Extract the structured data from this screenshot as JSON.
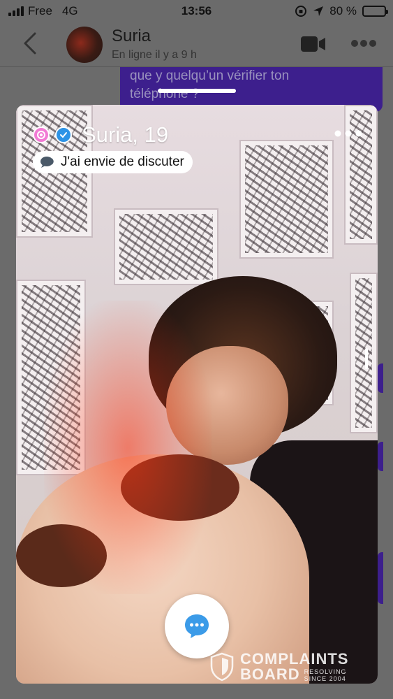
{
  "status_bar": {
    "carrier": "Free",
    "network": "4G",
    "time": "13:56",
    "battery_percent": "80 %",
    "battery_level": 0.8
  },
  "chat_header": {
    "contact_name": "Suria",
    "contact_status": "En ligne il y a 9 h"
  },
  "background_message": {
    "text_line1": "que y quelqu’un vérifier ton",
    "text_line2": "téléphone ?"
  },
  "profile_card": {
    "name_age": "Suria, 19",
    "mood": "J'ai envie de discuter",
    "photo_position": 0.1
  },
  "watermark": {
    "line1": "COMPLAINTS",
    "line2": "BOARD",
    "tagline1": "RESOLVING",
    "tagline2": "SINCE 2004"
  },
  "colors": {
    "accent_purple": "#3d1f8d",
    "verified_blue": "#2d93e6",
    "chat_button_blue": "#3b9be8",
    "badge_pink": "#f27ad4"
  },
  "icons": {
    "back": "chevron-left-icon",
    "video": "video-camera-icon",
    "more": "more-dots-icon",
    "verified": "verified-check-icon",
    "mood": "speech-bubble-icon",
    "chat": "chat-bubble-icon"
  }
}
